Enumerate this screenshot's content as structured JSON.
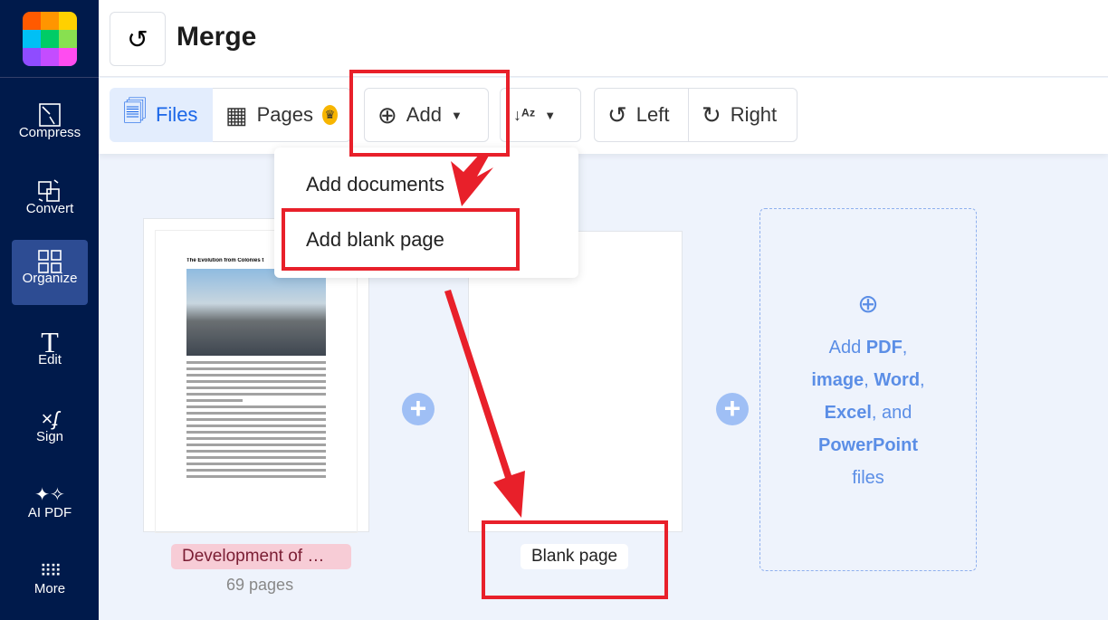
{
  "sidebar": {
    "items": [
      {
        "label": "Compress"
      },
      {
        "label": "Convert"
      },
      {
        "label": "Organize"
      },
      {
        "label": "Edit"
      },
      {
        "label": "Sign"
      },
      {
        "label": "AI PDF"
      },
      {
        "label": "More"
      }
    ],
    "logo_colors": [
      "#ff5a00",
      "#ff9500",
      "#ffd000",
      "#00c0f5",
      "#00cc66",
      "#88e050",
      "#8f4cff",
      "#c44cff",
      "#ff4cf0"
    ]
  },
  "header": {
    "title": "Merge"
  },
  "toolbar": {
    "files": "Files",
    "pages": "Pages",
    "add": "Add",
    "left": "Left",
    "right": "Right"
  },
  "dropdown": {
    "items": [
      "Add documents",
      "Add blank page"
    ]
  },
  "files": [
    {
      "doc_title": "The Evolution from Colonies t",
      "name": "Development of …",
      "pages": "69 pages"
    },
    {
      "name": "Blank page"
    }
  ],
  "add_box": {
    "l1a": "Add ",
    "l1b": "PDF",
    "l1c": ",",
    "l2a": "image",
    "l2b": ", ",
    "l2c": "Word",
    ",": ",",
    "l3a": "Excel",
    "l3b": ", and",
    "l4": "PowerPoint",
    "l5": "files"
  },
  "colors": {
    "annotation": "#e8202a",
    "accent": "#1a66e8",
    "sidebar": "#001a4b"
  }
}
